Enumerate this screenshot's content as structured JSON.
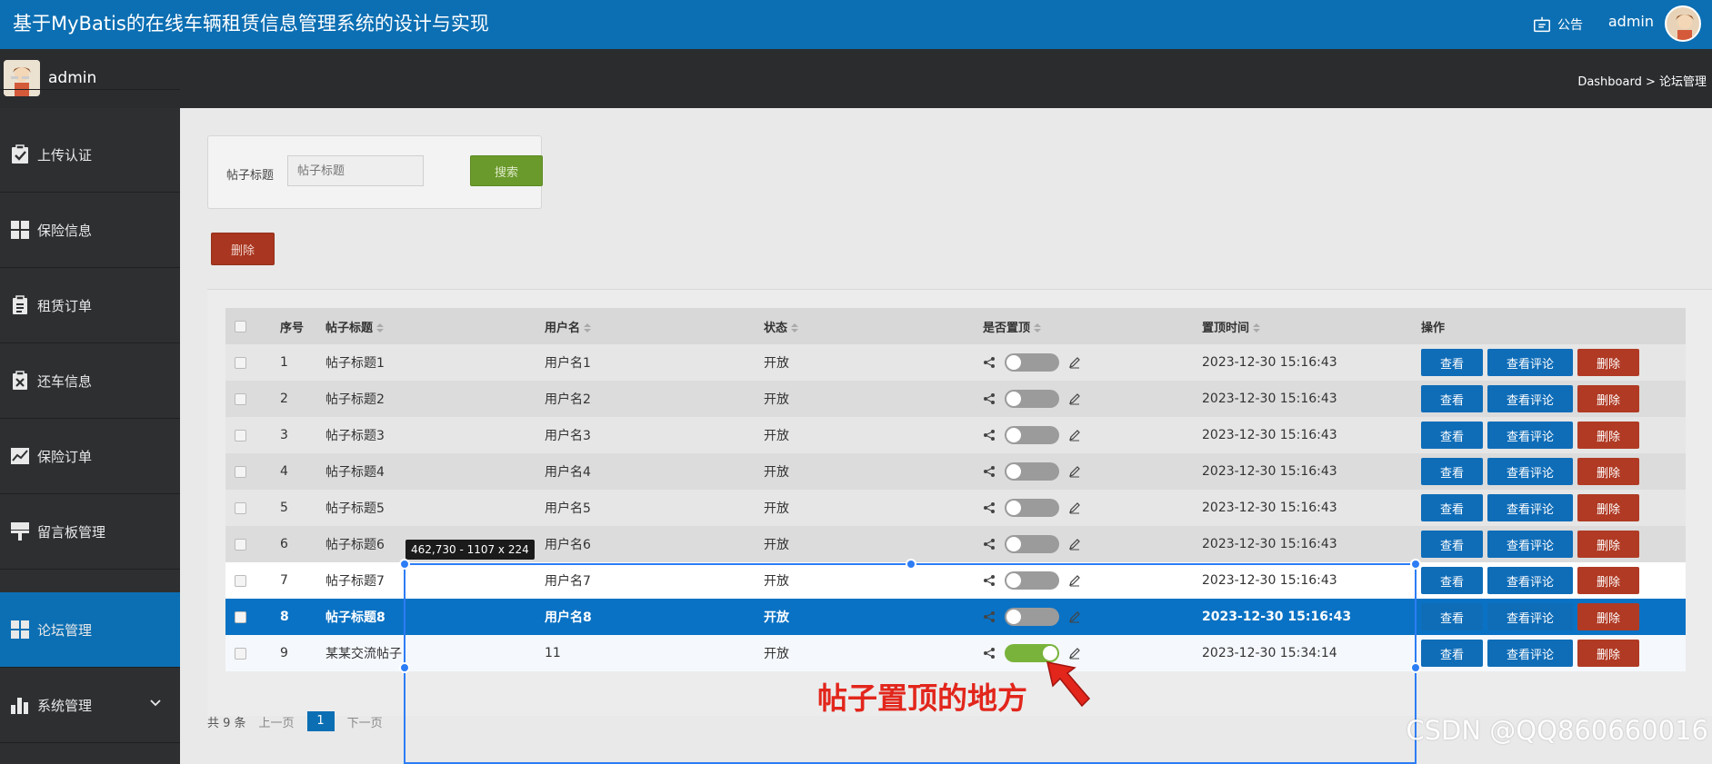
{
  "header": {
    "title": "基于MyBatis的在线车辆租赁信息管理系统的设计与实现",
    "notice_label": "公告",
    "user": "admin"
  },
  "subbar": {
    "user": "admin",
    "breadcrumb": "Dashboard > 论坛管理"
  },
  "sidebar": {
    "items": [
      {
        "label": "上传认证",
        "icon": "clipboard-check-icon"
      },
      {
        "label": "保险信息",
        "icon": "grid-icon"
      },
      {
        "label": "租赁订单",
        "icon": "clipboard-list-icon"
      },
      {
        "label": "还车信息",
        "icon": "clipboard-x-icon"
      },
      {
        "label": "保险订单",
        "icon": "chart-line-icon"
      },
      {
        "label": "留言板管理",
        "icon": "brush-icon"
      },
      {
        "label": "论坛管理",
        "icon": "grid-icon"
      },
      {
        "label": "系统管理",
        "icon": "bar-chart-icon"
      }
    ]
  },
  "search": {
    "label": "帖子标题",
    "placeholder": "帖子标题",
    "button": "搜索"
  },
  "actions": {
    "delete": "删除"
  },
  "table": {
    "headers": {
      "index": "序号",
      "title": "帖子标题",
      "username": "用户名",
      "status": "状态",
      "pinned": "是否置顶",
      "pin_time": "置顶时间",
      "ops": "操作"
    },
    "rows": [
      {
        "index": "1",
        "title": "帖子标题1",
        "username": "用户名1",
        "status": "开放",
        "pinned": false,
        "time": "2023-12-30 15:16:43"
      },
      {
        "index": "2",
        "title": "帖子标题2",
        "username": "用户名2",
        "status": "开放",
        "pinned": false,
        "time": "2023-12-30 15:16:43"
      },
      {
        "index": "3",
        "title": "帖子标题3",
        "username": "用户名3",
        "status": "开放",
        "pinned": false,
        "time": "2023-12-30 15:16:43"
      },
      {
        "index": "4",
        "title": "帖子标题4",
        "username": "用户名4",
        "status": "开放",
        "pinned": false,
        "time": "2023-12-30 15:16:43"
      },
      {
        "index": "5",
        "title": "帖子标题5",
        "username": "用户名5",
        "status": "开放",
        "pinned": false,
        "time": "2023-12-30 15:16:43"
      },
      {
        "index": "6",
        "title": "帖子标题6",
        "username": "用户名6",
        "status": "开放",
        "pinned": false,
        "time": "2023-12-30 15:16:43"
      },
      {
        "index": "7",
        "title": "帖子标题7",
        "username": "用户名7",
        "status": "开放",
        "pinned": false,
        "time": "2023-12-30 15:16:43"
      },
      {
        "index": "8",
        "title": "帖子标题8",
        "username": "用户名8",
        "status": "开放",
        "pinned": false,
        "time": "2023-12-30 15:16:43"
      },
      {
        "index": "9",
        "title": "某某交流帖子",
        "username": "11",
        "status": "开放",
        "pinned": true,
        "time": "2023-12-30 15:34:14"
      }
    ],
    "op_view": "查看",
    "op_comments": "查看评论",
    "op_delete": "删除"
  },
  "pager": {
    "total": "共 9 条",
    "prev": "上一页",
    "page": "1",
    "next": "下一页"
  },
  "overlay": {
    "dimension_label": "462,730 - 1107 x 224",
    "annotation": "帖子置顶的地方",
    "watermark": "CSDN @QQ860660016"
  },
  "colors": {
    "header_blue": "#0c6fb3",
    "sidebar_dark": "#2d2f31",
    "selected_row": "#0a72c4",
    "toggle_on": "#79b33b",
    "danger": "#b03a24"
  }
}
